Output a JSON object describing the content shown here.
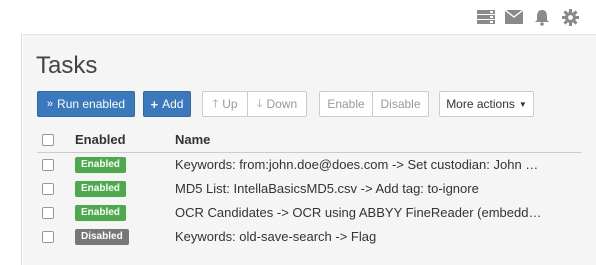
{
  "header": {
    "icons": [
      "server-icon",
      "envelope-icon",
      "bell-icon",
      "gear-icon"
    ]
  },
  "page": {
    "title": "Tasks"
  },
  "toolbar": {
    "run_enabled": "Run enabled",
    "add": "Add",
    "up": "Up",
    "down": "Down",
    "enable": "Enable",
    "disable": "Disable",
    "more_actions": "More actions"
  },
  "table": {
    "headers": {
      "enabled": "Enabled",
      "name": "Name"
    },
    "rows": [
      {
        "status": "Enabled",
        "name": "Keywords: from:john.doe@does.com -> Set custodian: John Doe"
      },
      {
        "status": "Enabled",
        "name": "MD5 List: IntellaBasicsMD5.csv -> Add tag: to-ignore"
      },
      {
        "status": "Enabled",
        "name": "OCR Candidates -> OCR using ABBYY FineReader (embedded)"
      },
      {
        "status": "Disabled",
        "name": "Keywords: old-save-search -> Flag"
      }
    ]
  },
  "colors": {
    "primary": "#3a79bd",
    "enabled_badge": "#4caa4c",
    "disabled_badge": "#777777",
    "panel_bg": "#f5f5f5"
  }
}
